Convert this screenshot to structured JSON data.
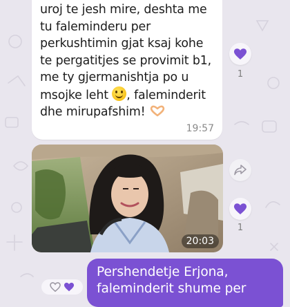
{
  "chat": {
    "incoming_text": {
      "lines": [
        "uroj te jesh mire, deshta me",
        "tu faleminderu per",
        "perkushtimin gjat ksaj kohe",
        "te pergatitjes se provimit b1,",
        "me ty gjermanishtja po u",
        "msojke leht",
        "dhe mirupafshim!"
      ],
      "line6_suffix": ", faleminderit",
      "emoji_smile": "smiling-face-icon",
      "emoji_heart_hands": "heart-hands-icon"
    },
    "incoming_time": "19:57",
    "incoming_reaction_count": "1",
    "image_message": {
      "time": "20:03",
      "reaction_count": "1"
    },
    "outgoing_text": {
      "lines": [
        "Pershendetje Erjona,",
        "faleminderit shume per"
      ]
    },
    "colors": {
      "background": "#e9e6ee",
      "accent": "#7b51d3",
      "heart": "#7b51d3"
    },
    "icons": {
      "reaction": "heart-icon",
      "forward": "share-forward-icon"
    }
  }
}
